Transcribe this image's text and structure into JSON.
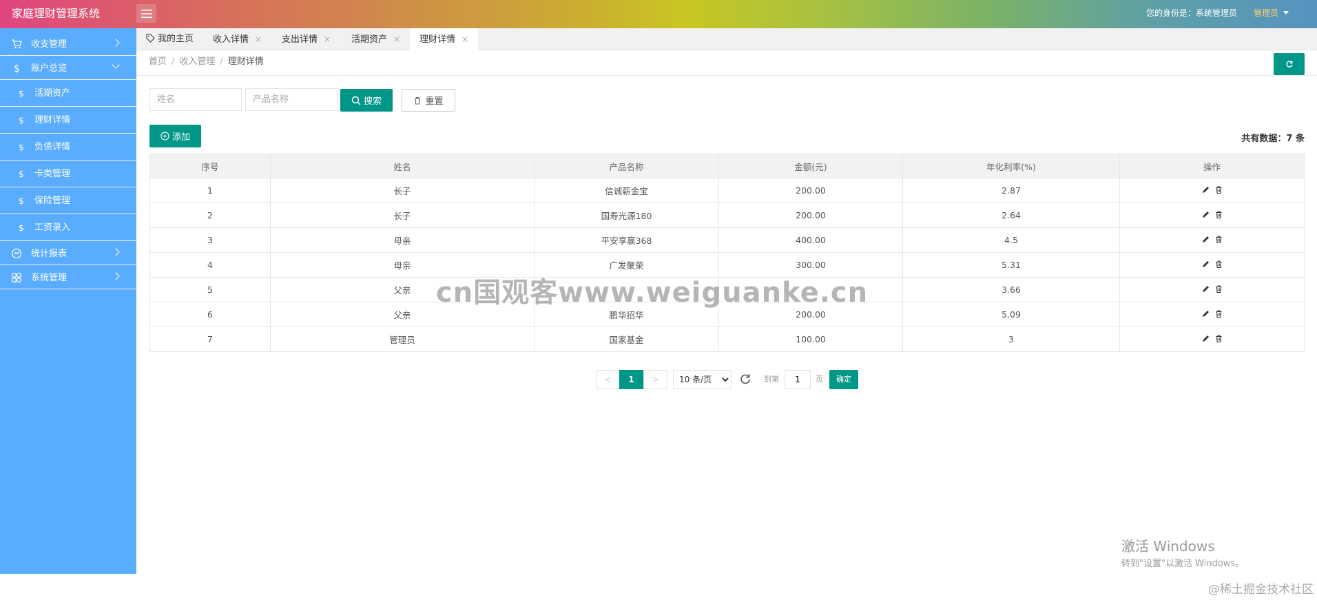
{
  "header": {
    "app_title": "家庭理财管理系统",
    "identity_label": "您的身份是：系统管理员",
    "role_label": "管理员"
  },
  "sidebar": {
    "items": [
      {
        "label": "收支管理",
        "icon": "cart-icon",
        "expanded": false
      },
      {
        "label": "账户总览",
        "icon": "dollar-icon",
        "expanded": true
      },
      {
        "label": "统计报表",
        "icon": "chart-icon",
        "expanded": false
      },
      {
        "label": "系统管理",
        "icon": "grid-icon",
        "expanded": false
      }
    ],
    "sub_icon": "$",
    "sub_items": [
      {
        "label": "活期资产"
      },
      {
        "label": "理财详情"
      },
      {
        "label": "负债详情"
      },
      {
        "label": "卡类管理"
      },
      {
        "label": "保险管理"
      },
      {
        "label": "工资录入"
      }
    ]
  },
  "tabs": [
    {
      "label": "我的主页",
      "closable": false,
      "active": false
    },
    {
      "label": "收入详情",
      "closable": true,
      "active": false
    },
    {
      "label": "支出详情",
      "closable": true,
      "active": false
    },
    {
      "label": "活期资产",
      "closable": true,
      "active": false
    },
    {
      "label": "理财详情",
      "closable": true,
      "active": true
    }
  ],
  "tab_close_glyph": "×",
  "breadcrumb": {
    "home": "首页",
    "section": "收入管理",
    "current": "理财详情",
    "separator": "/"
  },
  "search": {
    "name_placeholder": "姓名",
    "product_placeholder": "产品名称",
    "search_label": "搜索",
    "reset_label": "重置"
  },
  "toolbar": {
    "add_label": "添加",
    "total_text": "共有数据：7 条"
  },
  "table": {
    "columns": [
      "序号",
      "姓名",
      "产品名称",
      "金额(元)",
      "年化利率(%)",
      "操作"
    ],
    "rows": [
      [
        "1",
        "长子",
        "信诚薪金宝",
        "200.00",
        "2.87"
      ],
      [
        "2",
        "长子",
        "国寿光源180",
        "200.00",
        "2.64"
      ],
      [
        "3",
        "母亲",
        "平安享赢368",
        "400.00",
        "4.5"
      ],
      [
        "4",
        "母亲",
        "广发聚荣",
        "300.00",
        "5.31"
      ],
      [
        "5",
        "父亲",
        "",
        "",
        "3.66"
      ],
      [
        "6",
        "父亲",
        "鹏华招华",
        "200.00",
        "5.09"
      ],
      [
        "7",
        "管理员",
        "国家基金",
        "100.00",
        "3"
      ]
    ]
  },
  "pagination": {
    "prev": "<",
    "current_page": "1",
    "next": ">",
    "page_size": "10 条/页",
    "page_size_options": [
      "10 条/页"
    ],
    "goto_label": "到第",
    "page_unit": "页",
    "goto_value": "1",
    "confirm_label": "确定"
  },
  "overlays": {
    "watermark": "cn国观客www.weiguanke.cn",
    "activate_title": "激活 Windows",
    "activate_sub": "转到\"设置\"以激活 Windows。",
    "credit": "@稀土掘金技术社区"
  },
  "colors": {
    "sidebar": "#5aadfe",
    "primary": "#009688",
    "role_text": "#ffd36b"
  }
}
